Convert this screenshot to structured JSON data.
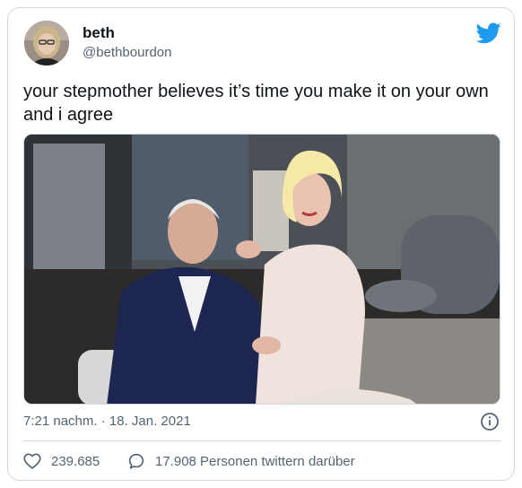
{
  "tweet": {
    "author_name": "beth",
    "author_handle": "@bethbourdon",
    "text": "your stepmother believes it’s time you make it on your own and i agree",
    "timestamp": "7:21 nachm. · 18. Jan. 2021",
    "likes_count": "239.685",
    "replies_text": "17.908 Personen twittern darüber"
  },
  "icons": {
    "brand": "twitter-bird-icon",
    "info": "info-icon",
    "like": "heart-icon",
    "reply": "speech-bubble-icon"
  },
  "colors": {
    "brand_blue": "#1d9bf0",
    "text_primary": "#0f1419",
    "text_secondary": "#536471",
    "border": "#cfd9de"
  }
}
